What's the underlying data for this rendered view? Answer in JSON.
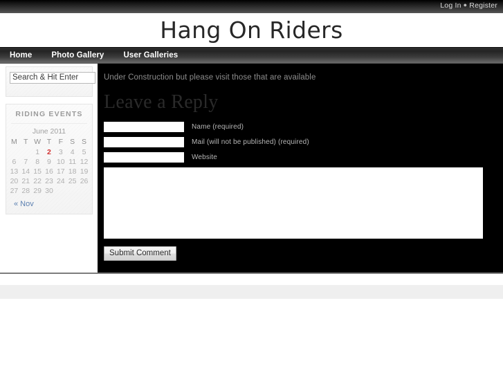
{
  "topbar": {
    "login_label": "Log In",
    "separator": "●",
    "register_label": "Register"
  },
  "header": {
    "site_title": "Hang On Riders"
  },
  "nav": {
    "items": [
      {
        "label": "Home"
      },
      {
        "label": "Photo Gallery"
      },
      {
        "label": "User Galleries"
      }
    ]
  },
  "sidebar": {
    "search": {
      "value": "Search & Hit Enter",
      "placeholder": "Search & Hit Enter"
    },
    "calendar": {
      "widget_title": "RIDING EVENTS",
      "caption": "June 2011",
      "day_headers": [
        "M",
        "T",
        "W",
        "T",
        "F",
        "S",
        "S"
      ],
      "weeks": [
        [
          "",
          "",
          "1",
          "2",
          "3",
          "4",
          "5"
        ],
        [
          "6",
          "7",
          "8",
          "9",
          "10",
          "11",
          "12"
        ],
        [
          "13",
          "14",
          "15",
          "16",
          "17",
          "18",
          "19"
        ],
        [
          "20",
          "21",
          "22",
          "23",
          "24",
          "25",
          "26"
        ],
        [
          "27",
          "28",
          "29",
          "30",
          "",
          "",
          ""
        ]
      ],
      "today": "2",
      "today_color": "#d03030",
      "prev_link": "« Nov"
    }
  },
  "main": {
    "intro_text": "Under Construction but please visit those that are available",
    "reply_heading": "Leave a Reply",
    "fields": [
      {
        "name": "name",
        "value": "",
        "label": "Name (required)"
      },
      {
        "name": "email",
        "value": "",
        "label": "Mail (will not be published) (required)"
      },
      {
        "name": "website",
        "value": "",
        "label": "Website"
      }
    ],
    "comment_value": "",
    "submit_label": "Submit Comment"
  },
  "colors": {
    "content_bg": "#000000",
    "nav_text": "#ffffff",
    "link_blue": "#5b7fb0",
    "muted_text": "#8d8d8d"
  }
}
